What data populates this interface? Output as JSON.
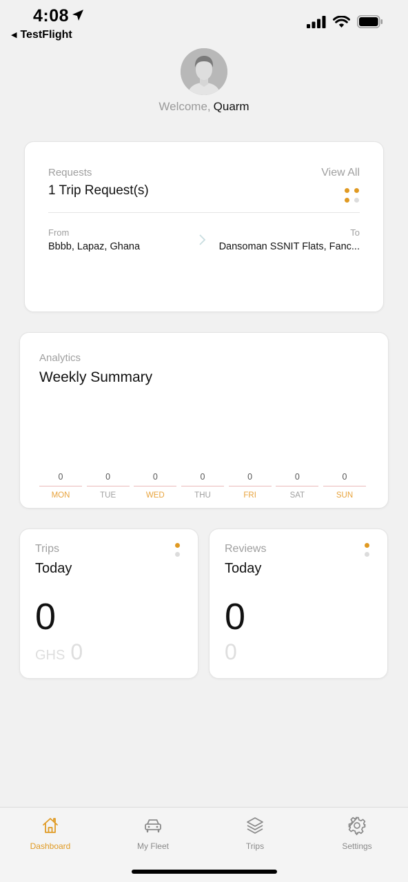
{
  "status_bar": {
    "time": "4:08",
    "back_app": "TestFlight",
    "icons": [
      "location-arrow-icon",
      "cellular-signal-icon",
      "wifi-icon",
      "battery-icon"
    ]
  },
  "profile": {
    "welcome": "Welcome,",
    "name": "Quarm",
    "avatar_icon": "user-avatar-icon"
  },
  "requests_card": {
    "label": "Requests",
    "title": "1 Trip Request(s)",
    "view_all": "View All",
    "from_label": "From",
    "from_value": "Bbbb, Lapaz, Ghana",
    "to_label": "To",
    "to_value": "Dansoman SSNIT Flats, Fanc..."
  },
  "analytics": {
    "label": "Analytics",
    "title": "Weekly Summary",
    "days": [
      {
        "name": "MON",
        "value": "0",
        "color": "#e8a33c"
      },
      {
        "name": "TUE",
        "value": "0",
        "color": "#9f9f9f"
      },
      {
        "name": "WED",
        "value": "0",
        "color": "#e8a33c"
      },
      {
        "name": "THU",
        "value": "0",
        "color": "#9f9f9f"
      },
      {
        "name": "FRI",
        "value": "0",
        "color": "#e8a33c"
      },
      {
        "name": "SAT",
        "value": "0",
        "color": "#9f9f9f"
      },
      {
        "name": "SUN",
        "value": "0",
        "color": "#e8a33c"
      }
    ]
  },
  "trips_card": {
    "label": "Trips",
    "title": "Today",
    "count": "0",
    "currency": "GHS",
    "amount": "0"
  },
  "reviews_card": {
    "label": "Reviews",
    "title": "Today",
    "count": "0",
    "sub_value": "0"
  },
  "tabbar": {
    "items": [
      {
        "label": "Dashboard",
        "icon": "home-icon",
        "active": true
      },
      {
        "label": "My Fleet",
        "icon": "car-icon",
        "active": false
      },
      {
        "label": "Trips",
        "icon": "layers-icon",
        "active": false
      },
      {
        "label": "Settings",
        "icon": "gear-icon",
        "active": false
      }
    ]
  },
  "colors": {
    "accent": "#e09a23",
    "muted_text": "#9f9f9f",
    "inactive_tab": "#8a8a8a",
    "background": "#f1f1f1",
    "card": "#ffffff"
  }
}
